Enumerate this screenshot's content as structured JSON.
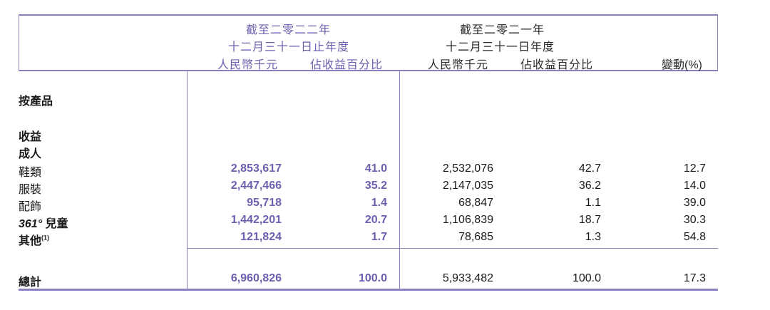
{
  "header": {
    "y2022_line1": "截至二零二二年",
    "y2022_line2": "十二月三十一日止年度",
    "y2022_col_rmb": "人民幣千元",
    "y2022_col_pct": "佔收益百分比",
    "y2021_line1": "截至二零二一年",
    "y2021_line2": "十二月三十一日年度",
    "y2021_col_rmb": "人民幣千元",
    "y2021_col_pct": "佔收益百分比",
    "change_col": "變動(%)"
  },
  "sections": {
    "by_product": "按產品",
    "revenue": "收益",
    "adult": "成人"
  },
  "rows": [
    {
      "label": "鞋類",
      "v2022": "2,853,617",
      "p2022": "41.0",
      "v2021": "2,532,076",
      "p2021": "42.7",
      "chg": "12.7"
    },
    {
      "label": "服裝",
      "v2022": "2,447,466",
      "p2022": "35.2",
      "v2021": "2,147,035",
      "p2021": "36.2",
      "chg": "14.0"
    },
    {
      "label": "配飾",
      "v2022": "95,718",
      "p2022": "1.4",
      "v2021": "68,847",
      "p2021": "1.1",
      "chg": "39.0"
    },
    {
      "label_prefix": "361°",
      "label": "兒童",
      "v2022": "1,442,201",
      "p2022": "20.7",
      "v2021": "1,106,839",
      "p2021": "18.7",
      "chg": "30.3"
    },
    {
      "label": "其他",
      "note": "(1)",
      "v2022": "121,824",
      "p2022": "1.7",
      "v2021": "78,685",
      "p2021": "1.3",
      "chg": "54.8"
    }
  ],
  "total": {
    "label": "總計",
    "v2022": "6,960,826",
    "p2022": "100.0",
    "v2021": "5,933,482",
    "p2021": "100.0",
    "chg": "17.3"
  }
}
